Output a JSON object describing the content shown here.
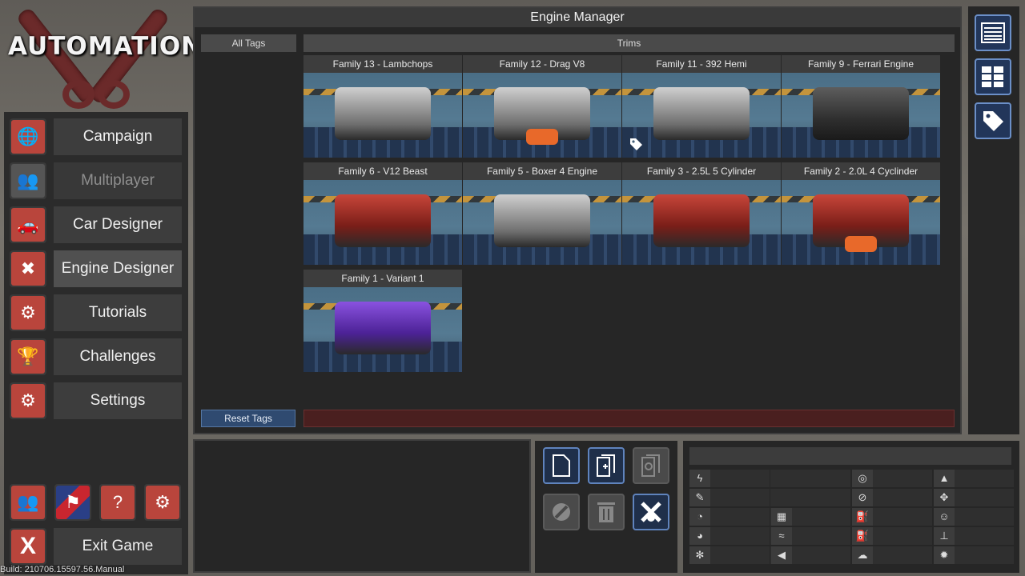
{
  "app": {
    "logo_text": "AUTOMATION",
    "build": "Build: 210706.15597.56.Manual"
  },
  "nav": {
    "items": [
      {
        "label": "Campaign",
        "icon": "globe-icon",
        "enabled": true
      },
      {
        "label": "Multiplayer",
        "icon": "users-icon",
        "enabled": false
      },
      {
        "label": "Car Designer",
        "icon": "car-icon",
        "enabled": true
      },
      {
        "label": "Engine Designer",
        "icon": "piston-icon",
        "enabled": true
      },
      {
        "label": "Tutorials",
        "icon": "head-gear-icon",
        "enabled": true
      },
      {
        "label": "Challenges",
        "icon": "trophy-icon",
        "enabled": true
      },
      {
        "label": "Settings",
        "icon": "gear-icon",
        "enabled": true
      }
    ],
    "exit_label": "Exit Game",
    "bottom_icons": [
      "community-icon",
      "language-flag-icon",
      "help-icon",
      "tutorial-head-icon"
    ]
  },
  "manager": {
    "title": "Engine Manager",
    "all_tags_label": "All Tags",
    "trims_label": "Trims",
    "reset_tags_label": "Reset Tags",
    "engines": [
      {
        "title": "Family 13 - Lambchops",
        "style": "silver",
        "exhaust": false,
        "tagged": false
      },
      {
        "title": "Family 12 - Drag V8",
        "style": "silver",
        "exhaust": true,
        "tagged": false
      },
      {
        "title": "Family 11 - 392 Hemi",
        "style": "silver",
        "exhaust": false,
        "tagged": true
      },
      {
        "title": "Family 9 - Ferrari Engine",
        "style": "dark",
        "exhaust": false,
        "tagged": false
      },
      {
        "title": "Family 6 - V12 Beast",
        "style": "red",
        "exhaust": false,
        "tagged": false
      },
      {
        "title": "Family 5 - Boxer 4 Engine",
        "style": "silver",
        "exhaust": false,
        "tagged": false
      },
      {
        "title": "Family 3 - 2.5L 5 Cylinder",
        "style": "red",
        "exhaust": false,
        "tagged": false
      },
      {
        "title": "Family 2 - 2.0L 4 Cyclinder",
        "style": "red",
        "exhaust": true,
        "tagged": false
      },
      {
        "title": "Family 1 - Variant 1",
        "style": "purple",
        "exhaust": false,
        "tagged": false
      }
    ]
  },
  "right_bar": {
    "buttons": [
      "list-view-icon",
      "grid-view-icon",
      "tag-icon"
    ]
  },
  "tools": {
    "buttons": [
      {
        "icon": "new-file-icon",
        "enabled": true
      },
      {
        "icon": "duplicate-file-icon",
        "enabled": true
      },
      {
        "icon": "settings-file-icon",
        "enabled": false
      },
      {
        "icon": "wrench-gear-icon",
        "enabled": false
      },
      {
        "icon": "trash-icon",
        "enabled": false
      },
      {
        "icon": "engine-designer-icon",
        "enabled": true
      }
    ]
  },
  "stats": {
    "icons": [
      [
        "lightning-icon",
        "",
        "turbo-icon",
        "",
        "weight-icon",
        ""
      ],
      [
        "wrench-icon",
        "",
        "piston-small-icon",
        "",
        "dimensions-icon",
        ""
      ],
      [
        "gauge-icon",
        "radiator-icon",
        "fuel-can-icon",
        "",
        "person-icon",
        ""
      ],
      [
        "tachometer-icon",
        "emissions-icon",
        "fuel-pump-icon",
        "",
        "anvil-icon",
        ""
      ],
      [
        "snowflake-icon",
        "speaker-icon",
        "smoke-icon",
        "",
        "gear-cog-icon",
        ""
      ]
    ]
  }
}
